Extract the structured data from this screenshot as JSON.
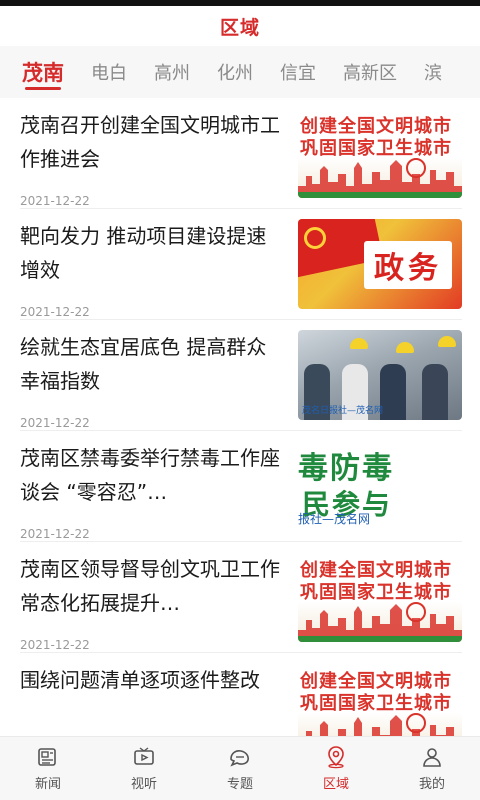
{
  "header": {
    "title": "区域"
  },
  "tabs": [
    {
      "label": "茂南",
      "active": true
    },
    {
      "label": "电白",
      "active": false
    },
    {
      "label": "高州",
      "active": false
    },
    {
      "label": "化州",
      "active": false
    },
    {
      "label": "信宜",
      "active": false
    },
    {
      "label": "高新区",
      "active": false
    },
    {
      "label": "滨",
      "active": false
    }
  ],
  "articles": [
    {
      "title": "茂南召开创建全国文明城市工作推进会",
      "date": "2021-12-22",
      "thumb": "civ",
      "thumb_text": [
        "创建全国文明城市",
        "巩固国家卫生城市"
      ]
    },
    {
      "title": "靶向发力 推动项目建设提速增效",
      "date": "2021-12-22",
      "thumb": "gov",
      "thumb_text": [
        "政务"
      ]
    },
    {
      "title": "绘就生态宜居底色 提高群众幸福指数",
      "date": "2021-12-22",
      "thumb": "photo",
      "thumb_text": [
        "茂名日报社—茂名网"
      ]
    },
    {
      "title": "茂南区禁毒委举行禁毒工作座谈会 “零容忍”…",
      "date": "2021-12-22",
      "thumb": "drug",
      "thumb_text": [
        "毒防毒",
        "民参与",
        "报社—茂名网"
      ]
    },
    {
      "title": "茂南区领导督导创文巩卫工作 常态化拓展提升…",
      "date": "2021-12-22",
      "thumb": "civ",
      "thumb_text": [
        "创建全国文明城市",
        "巩固国家卫生城市"
      ]
    },
    {
      "title": "围绕问题清单逐项逐件整改",
      "date": "2021-12-22",
      "thumb": "civ",
      "thumb_text": [
        "创建全国文明城市",
        "巩固国家卫生城市"
      ]
    }
  ],
  "bottom_nav": [
    {
      "label": "新闻",
      "icon": "news-icon",
      "active": false
    },
    {
      "label": "视听",
      "icon": "tv-icon",
      "active": false
    },
    {
      "label": "专题",
      "icon": "topic-icon",
      "active": false
    },
    {
      "label": "区域",
      "icon": "location-icon",
      "active": true
    },
    {
      "label": "我的",
      "icon": "profile-icon",
      "active": false
    }
  ],
  "colors": {
    "accent": "#d62b2b",
    "text": "#1b1b1b",
    "muted": "#9a9a9a"
  }
}
